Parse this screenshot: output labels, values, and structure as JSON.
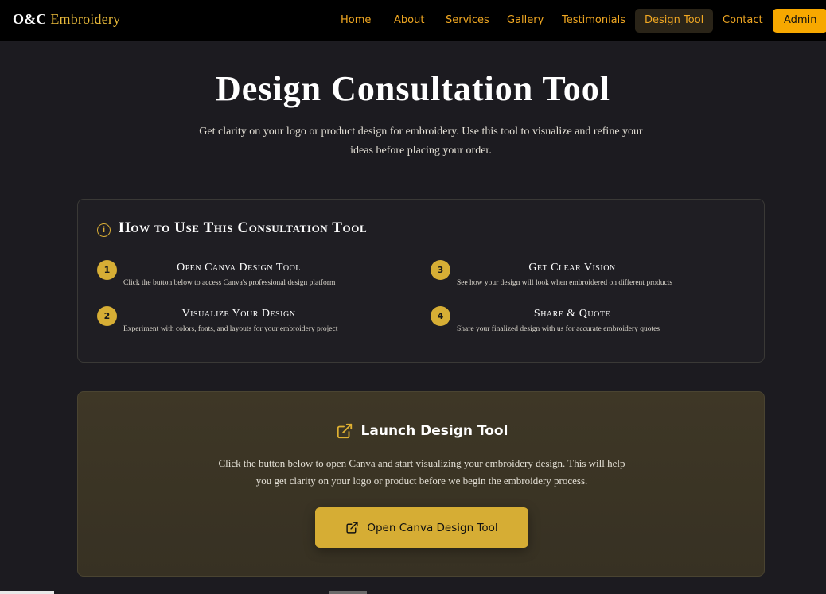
{
  "brand": {
    "part1": "O&C",
    "part2": "Embroidery"
  },
  "nav": {
    "items": [
      {
        "label": "Home"
      },
      {
        "label": "About"
      },
      {
        "label": "Services"
      },
      {
        "label": "Gallery"
      },
      {
        "label": "Testimonials"
      },
      {
        "label": "Design Tool"
      },
      {
        "label": "Contact"
      }
    ],
    "active": "Design Tool",
    "admin_label": "Admin"
  },
  "hero": {
    "title": "Design Consultation Tool",
    "subtitle": "Get clarity on your logo or product design for embroidery. Use this tool to visualize and refine your ideas before placing your order."
  },
  "howto": {
    "icon": "info-icon",
    "title": "How to Use This Consultation Tool",
    "steps": [
      {
        "num": "1",
        "title": "Open Canva Design Tool",
        "desc": "Click the button below to access Canva's professional design platform"
      },
      {
        "num": "2",
        "title": "Visualize Your Design",
        "desc": "Experiment with colors, fonts, and layouts for your embroidery project"
      },
      {
        "num": "3",
        "title": "Get Clear Vision",
        "desc": "See how your design will look when embroidered on different products"
      },
      {
        "num": "4",
        "title": "Share & Quote",
        "desc": "Share your finalized design with us for accurate embroidery quotes"
      }
    ]
  },
  "launch": {
    "icon": "external-link-icon",
    "title": "Launch Design Tool",
    "desc": "Click the button below to open Canva and start visualizing your embroidery design. This will help you get clarity on your logo or product before we begin the embroidery process.",
    "button_label": "Open Canva Design Tool"
  },
  "colors": {
    "accent": "#f0a722",
    "gold": "#d6ad34",
    "background": "#1c1b20",
    "nav_background": "#000000"
  }
}
